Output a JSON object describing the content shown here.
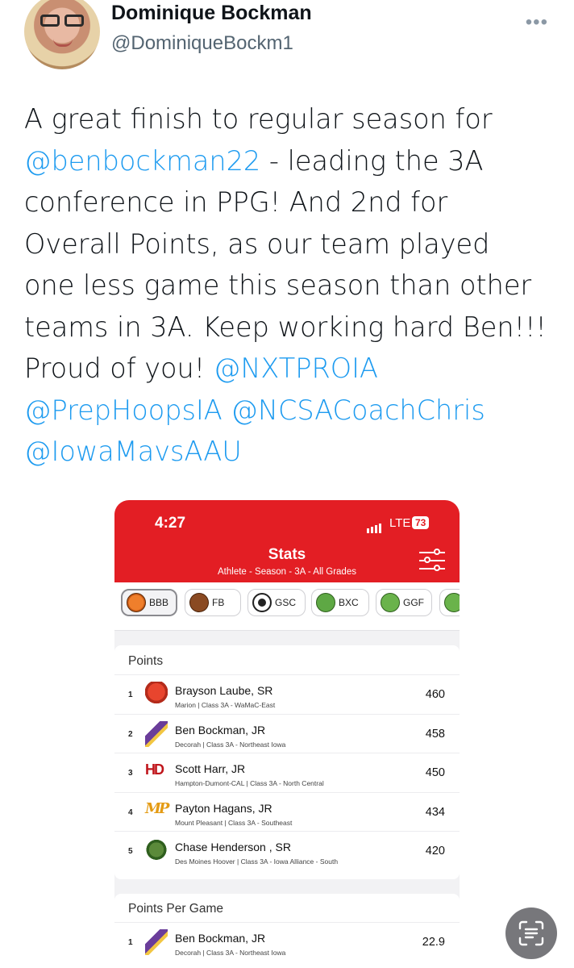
{
  "tweet": {
    "display_name": "Dominique Bockman",
    "handle": "@DominiqueBockm1",
    "more_icon": "more-horizontal-icon",
    "text_segments": [
      {
        "text": "A great finish to regular season for ",
        "mention": false
      },
      {
        "text": "@benbockman22",
        "mention": true
      },
      {
        "text": " - leading the 3A conference in PPG! And 2nd for Overall Points, as our team played one less game this season than other teams in 3A. Keep working hard Ben!!! Proud of you! ",
        "mention": false
      },
      {
        "text": "@NXTPROIA",
        "mention": true
      },
      {
        "text": " ",
        "mention": false
      },
      {
        "text": "@PrepHoopsIA",
        "mention": true
      },
      {
        "text": " ",
        "mention": false
      },
      {
        "text": "@NCSACoachChris",
        "mention": true
      },
      {
        "text": " ",
        "mention": false
      },
      {
        "text": "@IowaMavsAAU",
        "mention": true
      }
    ]
  },
  "app": {
    "status_time": "4:27",
    "network": "LTE",
    "battery": "73",
    "title": "Stats",
    "subtitle": "Athlete - Season - 3A - All Grades",
    "accent_color": "#e31e24",
    "sport_tabs": [
      {
        "label": "BBB",
        "icon": "basketball-icon",
        "active": true
      },
      {
        "label": "FB",
        "icon": "football-icon",
        "active": false
      },
      {
        "label": "GSC",
        "icon": "soccer-ball-icon",
        "active": false
      },
      {
        "label": "BXC",
        "icon": "cross-country-icon",
        "active": false
      },
      {
        "label": "GGF",
        "icon": "golf-icon",
        "active": false
      },
      {
        "label": "",
        "icon": "golf-icon",
        "active": false
      }
    ],
    "points": {
      "title": "Points",
      "rows": [
        {
          "rank": "1",
          "name": "Brayson Laube, SR",
          "meta": "Marion | Class 3A - WaMaC-East",
          "value": "460",
          "logo": "fox-logo"
        },
        {
          "rank": "2",
          "name": "Ben Bockman, JR",
          "meta": "Decorah | Class 3A - Northeast Iowa",
          "value": "458",
          "logo": "viking-logo"
        },
        {
          "rank": "3",
          "name": "Scott Harr, JR",
          "meta": "Hampton-Dumont-CAL | Class 3A - North Central",
          "value": "450",
          "logo": "hd-logo",
          "logo_text": "HD"
        },
        {
          "rank": "4",
          "name": "Payton Hagans, JR",
          "meta": "Mount Pleasant | Class 3A - Southeast",
          "value": "434",
          "logo": "mp-logo",
          "logo_text": "MP"
        },
        {
          "rank": "5",
          "name": "Chase Henderson , SR",
          "meta": "Des Moines Hoover | Class 3A - Iowa Alliance - South",
          "value": "420",
          "logo": "husky-logo"
        }
      ]
    },
    "ppg": {
      "title": "Points Per Game",
      "rows": [
        {
          "rank": "1",
          "name": "Ben Bockman, JR",
          "meta": "Decorah | Class 3A - Northeast Iowa",
          "value": "22.9",
          "logo": "viking-logo"
        }
      ]
    }
  },
  "scan_button_icon": "scan-text-icon"
}
